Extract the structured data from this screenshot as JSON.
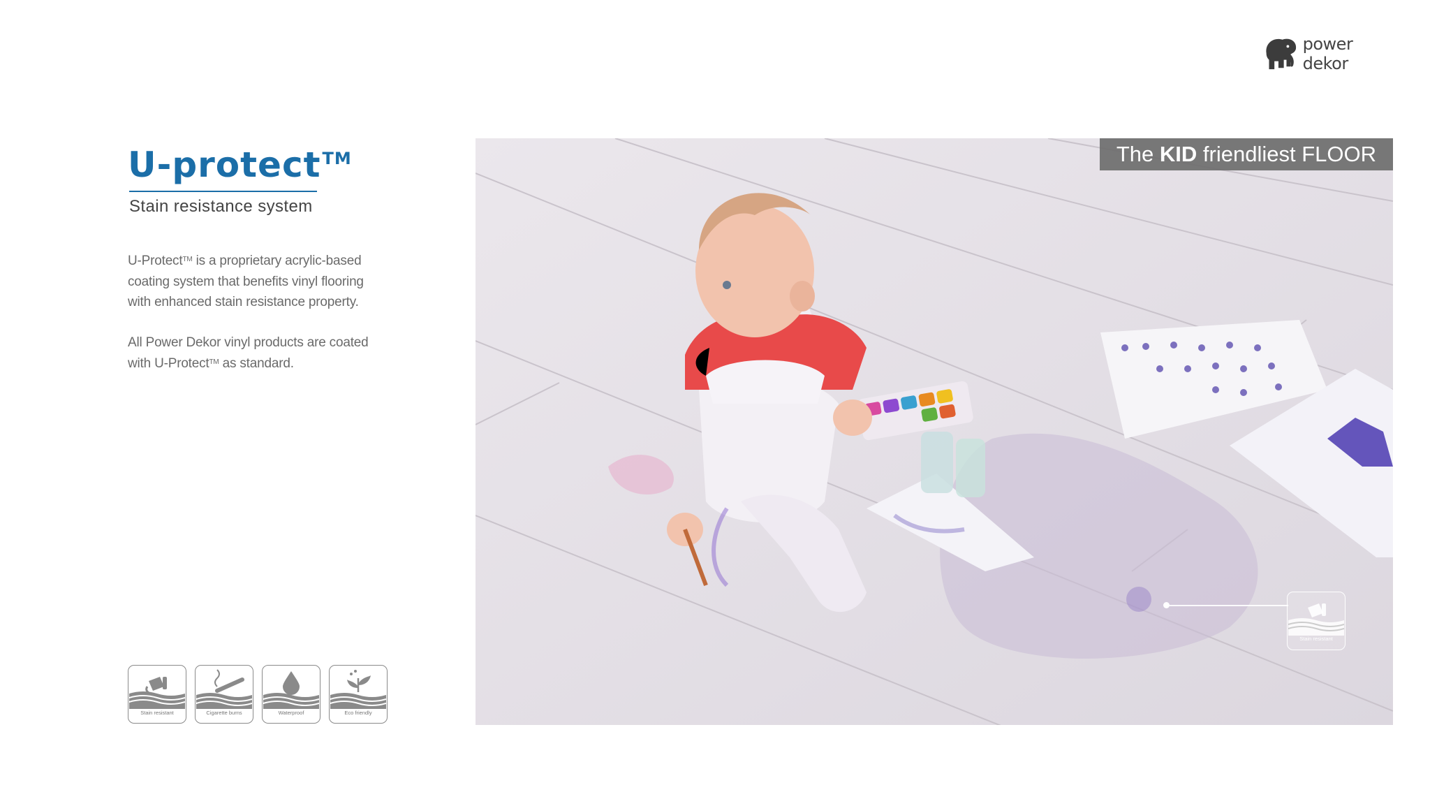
{
  "brand": {
    "logo_text": "power dekor",
    "logo_icon": "elephant-icon"
  },
  "heading": {
    "title": "U-protect",
    "title_mark": "TM",
    "subtitle": "Stain resistance system"
  },
  "body": {
    "p1_prefix": "U-Protect",
    "p1_mark": "TM",
    "p1_line1_rest": " is a proprietary acrylic-based",
    "p1_line2": "coating system that benefits vinyl flooring",
    "p1_line3": "with enhanced stain resistance property.",
    "p2_line1": "All Power Dekor vinyl products are coated",
    "p2_prefix": "with U-Protect",
    "p2_mark": "TM",
    "p2_suffix": " as standard."
  },
  "features": [
    {
      "label": "Stain resistant",
      "icon": "stain-resistant-icon"
    },
    {
      "label": "Cigarette burns",
      "icon": "cigarette-icon"
    },
    {
      "label": "Waterproof",
      "icon": "water-drop-icon"
    },
    {
      "label": "Eco friendly",
      "icon": "leaf-icon"
    }
  ],
  "photo": {
    "banner_pre": "The ",
    "banner_bold": "KID",
    "banner_post": " friendliest FLOOR",
    "callout_label": "Stain resistant",
    "callout_icon": "stain-resistant-icon"
  },
  "colors": {
    "accent": "#1b6ea8",
    "banner_bg": "#6e6e6e",
    "text_gray": "#6a6a6a"
  }
}
